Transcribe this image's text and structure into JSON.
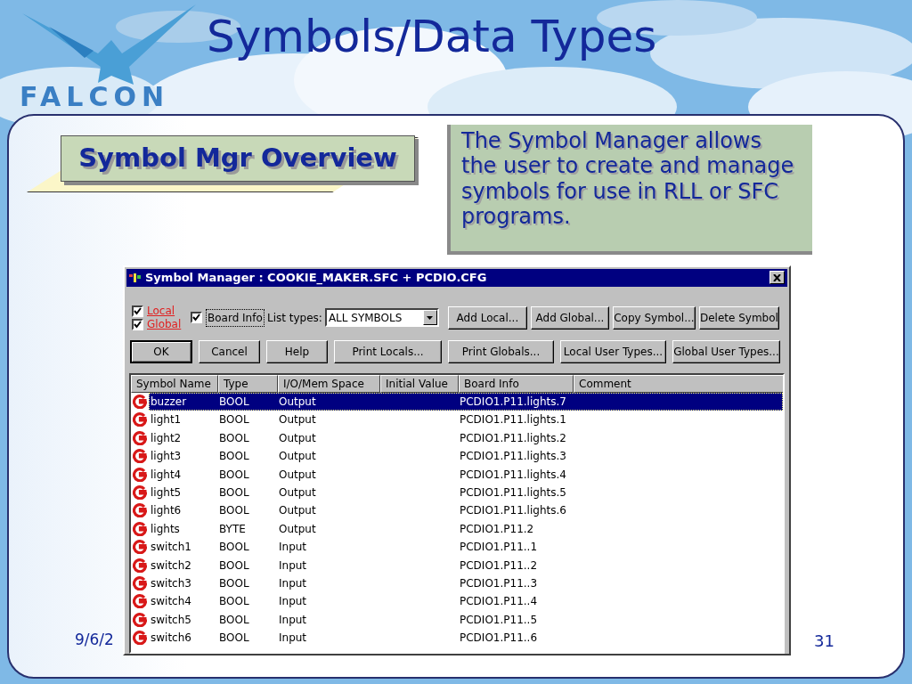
{
  "slide": {
    "title": "Symbols/Data Types",
    "logo_text": "FALCON",
    "heading": "Symbol Mgr Overview",
    "description": "The Symbol Manager allows the user to create and manage symbols for use in RLL or SFC programs.",
    "date": "9/6/2",
    "page_number": "31"
  },
  "window": {
    "title": "Symbol Manager : COOKIE_MAKER.SFC + PCDIO.CFG",
    "scopes": [
      {
        "label": "Local",
        "checked": true
      },
      {
        "label": "Global",
        "checked": true
      }
    ],
    "board_info": {
      "label": "Board Info",
      "checked": true,
      "focused": true
    },
    "list_types": {
      "label": "List types:",
      "value": "ALL SYMBOLS"
    },
    "buttons_row_1": [
      {
        "label": "Add Local...",
        "default": false
      },
      {
        "label": "Add Global...",
        "default": false
      },
      {
        "label": "Copy Symbol...",
        "default": false
      },
      {
        "label": "Delete Symbol",
        "default": false
      }
    ],
    "buttons_row_2": [
      {
        "label": "OK",
        "default": true
      },
      {
        "label": "Cancel",
        "default": false
      },
      {
        "label": "Help",
        "default": false
      },
      {
        "label": "Print Locals...",
        "default": false
      },
      {
        "label": "Print Globals...",
        "default": false
      },
      {
        "label": "Local User Types...",
        "default": false
      },
      {
        "label": "Global User Types...",
        "default": false
      }
    ],
    "table": {
      "columns": [
        "Symbol Name",
        "Type",
        "I/O/Mem Space",
        "Initial Value",
        "Board Info",
        "Comment"
      ],
      "rows": [
        {
          "name": "buzzer",
          "type": "BOOL",
          "space": "Output",
          "board_info": "PCDIO1.P11.lights.7",
          "selected": true
        },
        {
          "name": "light1",
          "type": "BOOL",
          "space": "Output",
          "board_info": "PCDIO1.P11.lights.1",
          "selected": false
        },
        {
          "name": "light2",
          "type": "BOOL",
          "space": "Output",
          "board_info": "PCDIO1.P11.lights.2",
          "selected": false
        },
        {
          "name": "light3",
          "type": "BOOL",
          "space": "Output",
          "board_info": "PCDIO1.P11.lights.3",
          "selected": false
        },
        {
          "name": "light4",
          "type": "BOOL",
          "space": "Output",
          "board_info": "PCDIO1.P11.lights.4",
          "selected": false
        },
        {
          "name": "light5",
          "type": "BOOL",
          "space": "Output",
          "board_info": "PCDIO1.P11.lights.5",
          "selected": false
        },
        {
          "name": "light6",
          "type": "BOOL",
          "space": "Output",
          "board_info": "PCDIO1.P11.lights.6",
          "selected": false
        },
        {
          "name": "lights",
          "type": "BYTE",
          "space": "Output",
          "board_info": "PCDIO1.P11.2",
          "selected": false
        },
        {
          "name": "switch1",
          "type": "BOOL",
          "space": "Input",
          "board_info": "PCDIO1.P11..1",
          "selected": false
        },
        {
          "name": "switch2",
          "type": "BOOL",
          "space": "Input",
          "board_info": "PCDIO1.P11..2",
          "selected": false
        },
        {
          "name": "switch3",
          "type": "BOOL",
          "space": "Input",
          "board_info": "PCDIO1.P11..3",
          "selected": false
        },
        {
          "name": "switch4",
          "type": "BOOL",
          "space": "Input",
          "board_info": "PCDIO1.P11..4",
          "selected": false
        },
        {
          "name": "switch5",
          "type": "BOOL",
          "space": "Input",
          "board_info": "PCDIO1.P11..5",
          "selected": false
        },
        {
          "name": "switch6",
          "type": "BOOL",
          "space": "Input",
          "board_info": "PCDIO1.P11..6",
          "selected": false
        }
      ]
    }
  }
}
